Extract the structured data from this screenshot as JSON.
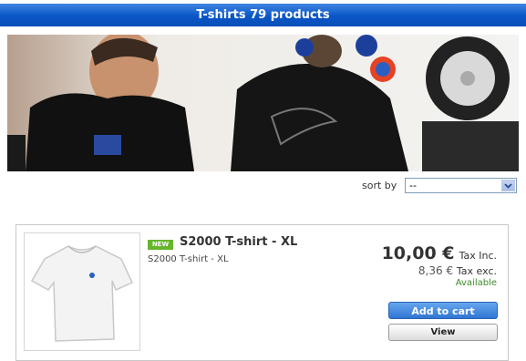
{
  "header": {
    "title": "T-shirts 79 products"
  },
  "sort": {
    "label": "sort by",
    "selected": "--"
  },
  "product": {
    "badge": "NEW",
    "name": "S2000 T-shirt - XL",
    "description": "S2000 T-shirt - XL",
    "price": "10,00 €",
    "price_tax_label": "Tax Inc.",
    "price_excl": "8,36 €",
    "price_excl_label": "Tax exc.",
    "availability": "Available",
    "add_to_cart_label": "Add to cart",
    "view_label": "View"
  },
  "colors": {
    "header_blue": "#0a55c8",
    "button_blue": "#2f76d2",
    "badge_green": "#66b52c",
    "available_green": "#3b8a2a"
  }
}
